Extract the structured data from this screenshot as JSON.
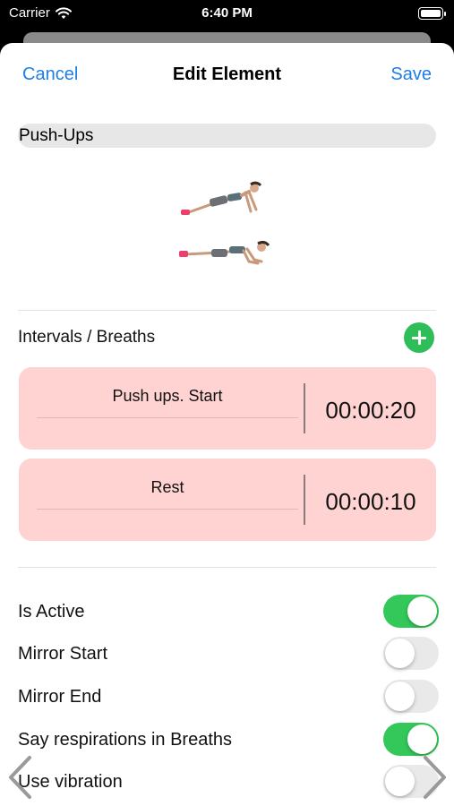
{
  "status_bar": {
    "carrier": "Carrier",
    "time": "6:40 PM"
  },
  "nav": {
    "cancel": "Cancel",
    "title": "Edit Element",
    "save": "Save"
  },
  "exercise": {
    "name": "Push-Ups"
  },
  "intervals": {
    "title": "Intervals / Breaths",
    "items": [
      {
        "label": "Push ups. Start",
        "duration": "00:00:20"
      },
      {
        "label": "Rest",
        "duration": "00:00:10"
      }
    ]
  },
  "settings": [
    {
      "label": "Is Active",
      "on": true
    },
    {
      "label": "Mirror Start",
      "on": false
    },
    {
      "label": "Mirror End",
      "on": false
    },
    {
      "label": "Say respirations in Breaths",
      "on": true
    },
    {
      "label": "Use vibration",
      "on": false
    }
  ],
  "colors": {
    "accent": "#1e7ee8",
    "add": "#2dbe5a",
    "toggle_on": "#34c759",
    "interval_bg": "#ffd3d1"
  },
  "icons": [
    "wifi-icon",
    "battery-icon",
    "plus-icon",
    "chevron-left-icon",
    "chevron-right-icon"
  ]
}
